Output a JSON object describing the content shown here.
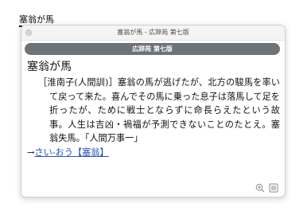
{
  "host": {
    "selected_word": "塞翁が馬"
  },
  "window": {
    "title": "塞翁が馬 - 広辞苑 第七版"
  },
  "dictionary_tab": {
    "label": "広辞苑 第七版"
  },
  "entry": {
    "headword": "塞翁が馬",
    "definition": "［淮南子(人間訓)］塞翁の馬が逃げたが、北方の駿馬を率いて戻って来た。喜んでその馬に乗った息子は落馬して足を折ったが、ために戦士とならずに命長らえたという故事。人生は吉凶・禍福が予測できないことのたとえ。塞翁失馬。「人間万事一」",
    "xref_arrow": "→",
    "xref_text": "さい-おう【塞翁】"
  },
  "icons": {
    "zoom": "zoom-in-icon",
    "menu": "list-menu-icon"
  },
  "colors": {
    "link": "#2a53b8",
    "tab_bg": "#6e7378"
  }
}
